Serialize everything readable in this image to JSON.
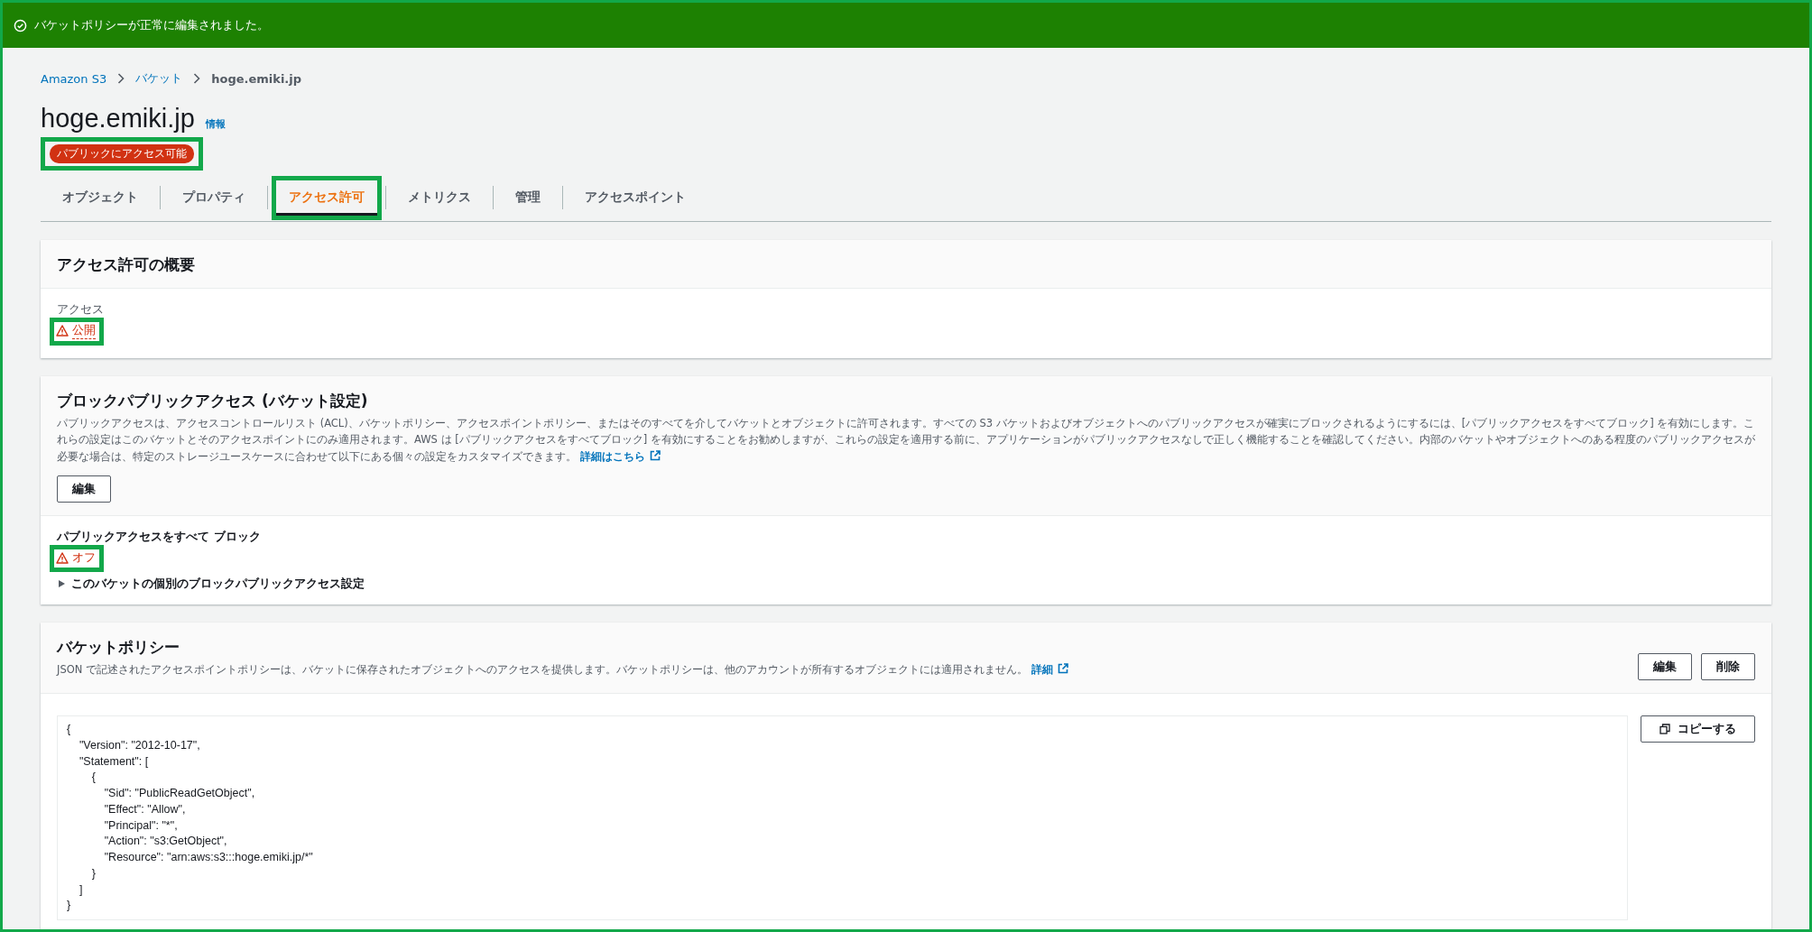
{
  "flash": {
    "message": "バケットポリシーが正常に編集されました。"
  },
  "breadcrumbs": [
    {
      "label": "Amazon S3",
      "link": true
    },
    {
      "label": "バケット",
      "link": true
    },
    {
      "label": "hoge.emiki.jp",
      "link": false
    }
  ],
  "header": {
    "title": "hoge.emiki.jp",
    "info": "情報",
    "badge": "パブリックにアクセス可能",
    "badge_highlighted": true
  },
  "tabs": [
    {
      "label": "オブジェクト",
      "selected": false,
      "highlighted": false
    },
    {
      "label": "プロパティ",
      "selected": false,
      "highlighted": false
    },
    {
      "label": "アクセス許可",
      "selected": true,
      "highlighted": true
    },
    {
      "label": "メトリクス",
      "selected": false,
      "highlighted": false
    },
    {
      "label": "管理",
      "selected": false,
      "highlighted": false
    },
    {
      "label": "アクセスポイント",
      "selected": false,
      "highlighted": false
    }
  ],
  "overview": {
    "title": "アクセス許可の概要",
    "label": "アクセス",
    "value": "公開",
    "highlighted": true
  },
  "block_public_access": {
    "title": "ブロックパブリックアクセス (バケット設定)",
    "description": "パブリックアクセスは、アクセスコントロールリスト (ACL)、バケットポリシー、アクセスポイントポリシー、またはそのすべてを介してバケットとオブジェクトに許可されます。すべての S3 バケットおよびオブジェクトへのパブリックアクセスが確実にブロックされるようにするには、[パブリックアクセスをすべてブロック] を有効にします。これらの設定はこのバケットとそのアクセスポイントにのみ適用されます。AWS は [パブリックアクセスをすべてブロック] を有効にすることをお勧めしますが、これらの設定を適用する前に、アプリケーションがパブリックアクセスなしで正しく機能することを確認してください。内部のバケットやオブジェクトへのある程度のパブリックアクセスが必要な場合は、特定のストレージユースケースに合わせて以下にある個々の設定をカスタマイズできます。",
    "link": "詳細はこちら",
    "edit_button": "編集",
    "setting_label": "パブリックアクセスをすべて ブロック",
    "setting_value": "オフ",
    "highlighted": true,
    "expander": {
      "label": "このバケットの個別のブロックパブリックアクセス設定",
      "expanded": false
    }
  },
  "bucket_policy": {
    "title": "バケットポリシー",
    "description": "JSON で記述されたアクセスポイントポリシーは、バケットに保存されたオブジェクトへのアクセスを提供します。バケットポリシーは、他のアカウントが所有するオブジェクトには適用されません。",
    "link": "詳細",
    "buttons": [
      "編集",
      "削除"
    ],
    "copy_button": "コピーする",
    "code": "{\n    \"Version\": \"2012-10-17\",\n    \"Statement\": [\n        {\n            \"Sid\": \"PublicReadGetObject\",\n            \"Effect\": \"Allow\",\n            \"Principal\": \"*\",\n            \"Action\": \"s3:GetObject\",\n            \"Resource\": \"arn:aws:s3:::hoge.emiki.jp/*\"\n        }\n    ]\n}"
  }
}
